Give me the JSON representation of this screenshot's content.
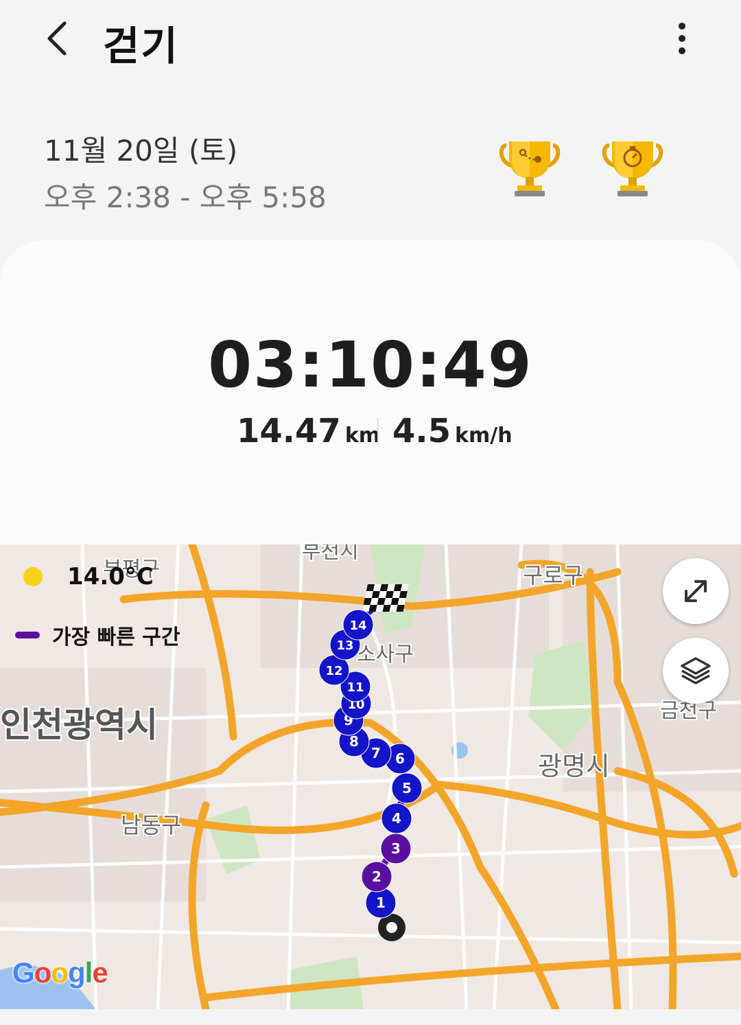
{
  "header": {
    "title": "걷기",
    "back_icon": "chevron-left-icon",
    "more_icon": "more-vert-icon"
  },
  "session": {
    "date": "11월 20일 (토)",
    "time_range": "오후 2:38 - 오후 5:58",
    "trophies": [
      {
        "icon": "trophy-distance-icon"
      },
      {
        "icon": "trophy-duration-icon"
      }
    ]
  },
  "summary": {
    "duration": "03:10:49",
    "distance_value": "14.47",
    "distance_unit": "km",
    "speed_value": "4.5",
    "speed_unit": "km/h"
  },
  "map": {
    "weather_icon": "sun-icon",
    "temperature": "14.0°C",
    "legend_label": "가장 빠른 구간",
    "legend_color": "#5a0fa0",
    "route_color": "#1414c8",
    "fast_segment_color": "#5a0fa0",
    "place_labels": [
      "인천광역시",
      "구로구",
      "광명시",
      "남동구",
      "금천구",
      "부천시",
      "소사구",
      "부평구"
    ],
    "markers": [
      "1",
      "2",
      "3",
      "4",
      "5",
      "6",
      "7",
      "8",
      "9",
      "10",
      "11",
      "12",
      "13",
      "14"
    ],
    "fast_markers": [
      "2",
      "3"
    ],
    "expand_icon": "expand-icon",
    "layers_icon": "layers-icon",
    "attribution": "Google"
  }
}
